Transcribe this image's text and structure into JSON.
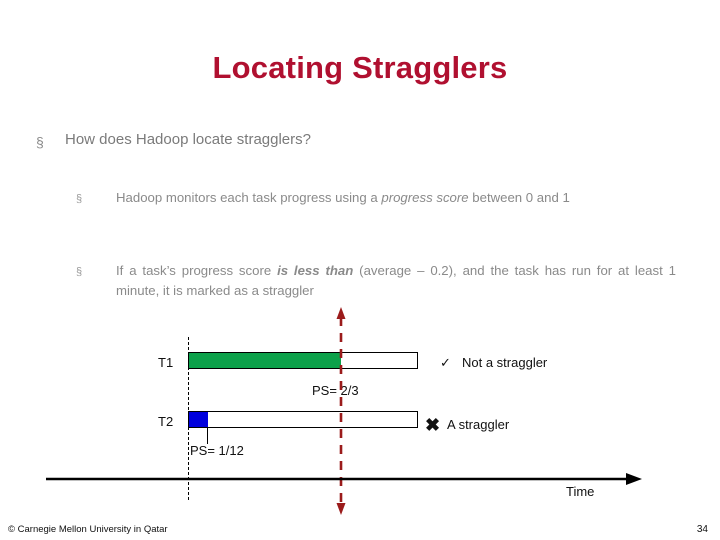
{
  "slide": {
    "title": "Locating Stragglers",
    "title_color": "#B01030",
    "bullets": [
      {
        "marker": "§",
        "level": 1,
        "text": "How does Hadoop locate stragglers?"
      }
    ],
    "sub_bullets": [
      {
        "marker": "§",
        "level": 2,
        "parts": [
          {
            "text": "Hadoop monitors each task progress using a ",
            "style": "normal"
          },
          {
            "text": "progress score",
            "style": "italic"
          },
          {
            "text": " between 0 and 1",
            "style": "normal"
          }
        ],
        "plain": "Hadoop monitors each task progress using a progress score between 0 and 1"
      },
      {
        "marker": "§",
        "level": 2,
        "parts": [
          {
            "text": "If a task’s progress score ",
            "style": "normal"
          },
          {
            "text": "is less than",
            "style": "bold-italic"
          },
          {
            "text": " (average – 0.2), and the task has run for at least 1 minute, it is marked as a straggler",
            "style": "normal"
          }
        ],
        "plain": "If a task’s progress score is less than (average – 0.2), and the task has run for at least 1 minute, it is marked as a straggler"
      }
    ]
  },
  "diagram": {
    "tasks": [
      {
        "label": "T1",
        "progress_label": "PS= 2/3",
        "progress_fraction": "2/3",
        "fill_color": "#0CA14A",
        "verdict": "Not a straggler",
        "verdict_glyph": "✓"
      },
      {
        "label": "T2",
        "progress_label": "PS= 1/12",
        "progress_fraction": "1/12",
        "fill_color": "#0000DD",
        "verdict": "A straggler",
        "verdict_glyph": "✖"
      }
    ],
    "axis_label": "Time",
    "marker_line_color": "#9B1B1B",
    "start_line_color": "#000000",
    "axis_color": "#000000"
  },
  "footer": {
    "copyright": "© Carnegie Mellon University in Qatar",
    "page_number": "34"
  }
}
